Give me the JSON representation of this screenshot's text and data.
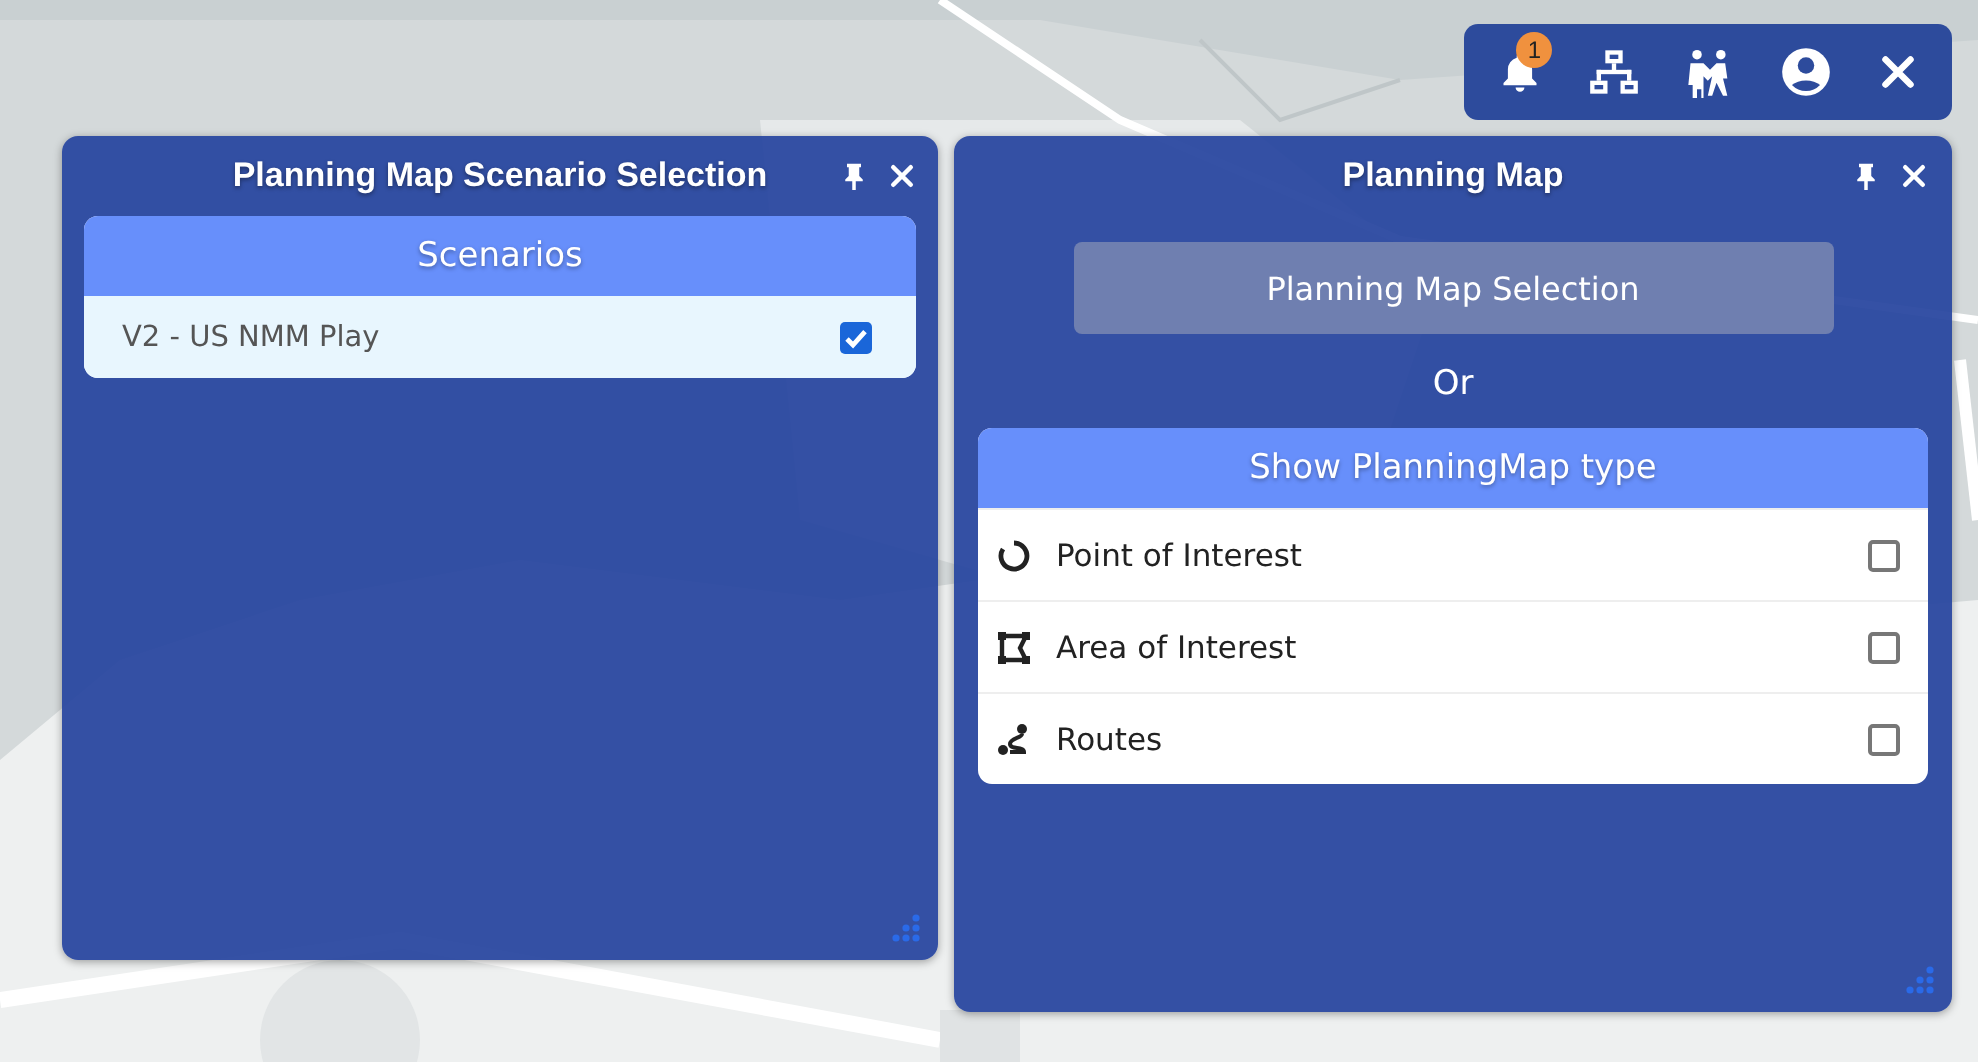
{
  "toolbar": {
    "notification_count": "1"
  },
  "scenario_panel": {
    "title": "Planning Map Scenario Selection",
    "list_header": "Scenarios",
    "scenarios": [
      {
        "label": "V2 - US NMM Play",
        "checked": true
      }
    ]
  },
  "planning_panel": {
    "title": "Planning Map",
    "selection_button": "Planning Map Selection",
    "separator": "Or",
    "list_header": "Show PlanningMap type",
    "types": [
      {
        "kind": "point",
        "label": "Point of Interest",
        "checked": false
      },
      {
        "kind": "area",
        "label": "Area of Interest",
        "checked": false
      },
      {
        "kind": "route",
        "label": "Routes",
        "checked": false
      }
    ]
  }
}
